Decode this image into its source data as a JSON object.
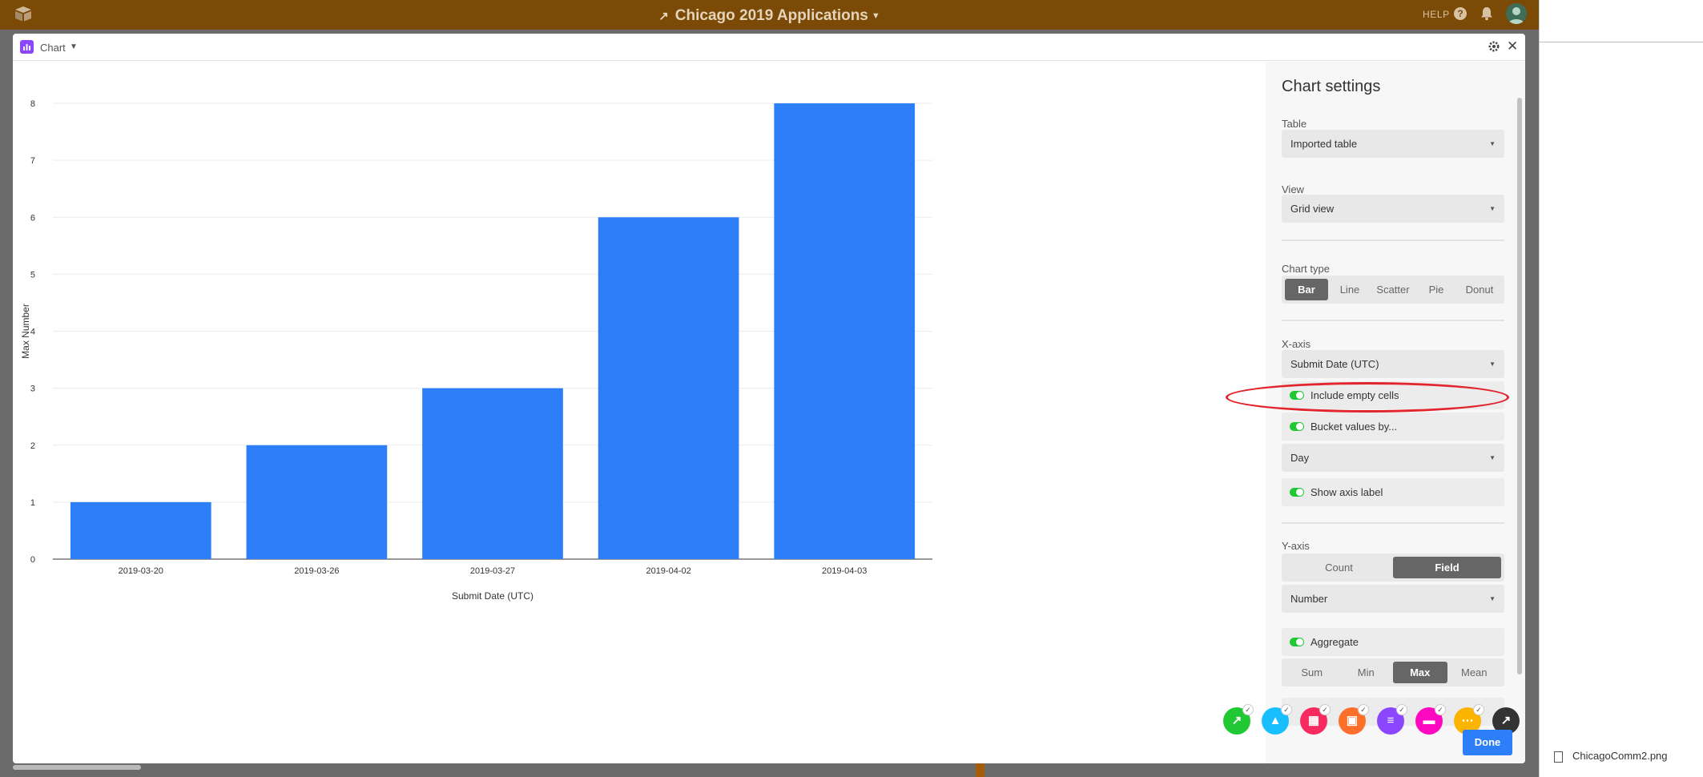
{
  "app": {
    "title": "Chicago 2019 Applications",
    "help_label": "HELP"
  },
  "modal": {
    "title": "Chart",
    "done_label": "Done"
  },
  "settings": {
    "heading": "Chart settings",
    "table_label": "Table",
    "table_value": "Imported table",
    "view_label": "View",
    "view_value": "Grid view",
    "chart_type_label": "Chart type",
    "chart_types": [
      "Bar",
      "Line",
      "Scatter",
      "Pie",
      "Donut"
    ],
    "chart_type_selected": "Bar",
    "xaxis_label": "X-axis",
    "xaxis_value": "Submit Date (UTC)",
    "include_empty_label": "Include empty cells",
    "bucket_label": "Bucket values by...",
    "bucket_value": "Day",
    "show_axis_label": "Show axis label",
    "yaxis_label": "Y-axis",
    "yaxis_modes": [
      "Count",
      "Field"
    ],
    "yaxis_mode_selected": "Field",
    "yaxis_field_value": "Number",
    "aggregate_label": "Aggregate",
    "aggregate_options": [
      "Sum",
      "Min",
      "Max",
      "Mean"
    ],
    "aggregate_selected": "Max"
  },
  "download": {
    "filename": "ChicagoComm2.png"
  },
  "colors": {
    "bar": "#2d7ff9",
    "topbar": "#7a4a06",
    "toggle_on": "#20c933",
    "highlight": "#e2242c"
  },
  "apps": [
    {
      "icon": "expand-icon",
      "color": "#20c933"
    },
    {
      "icon": "shapes-icon",
      "color": "#18bfff"
    },
    {
      "icon": "grid-icon",
      "color": "#f82b60"
    },
    {
      "icon": "image-icon",
      "color": "#ff6f2c"
    },
    {
      "icon": "list-icon",
      "color": "#8b46ff"
    },
    {
      "icon": "chat-icon",
      "color": "#ff08c2"
    },
    {
      "icon": "more-icon",
      "color": "#fcb400"
    },
    {
      "icon": "wrench-icon",
      "color": "#333333"
    }
  ],
  "chart_data": {
    "type": "bar",
    "categories": [
      "2019-03-20",
      "2019-03-26",
      "2019-03-27",
      "2019-04-02",
      "2019-04-03"
    ],
    "values": [
      1,
      2,
      3,
      6,
      8
    ],
    "xlabel": "Submit Date (UTC)",
    "ylabel": "Max Number",
    "ylim": [
      0,
      8
    ],
    "yticks": [
      0,
      1,
      2,
      3,
      4,
      5,
      6,
      7,
      8
    ],
    "grid": true
  }
}
